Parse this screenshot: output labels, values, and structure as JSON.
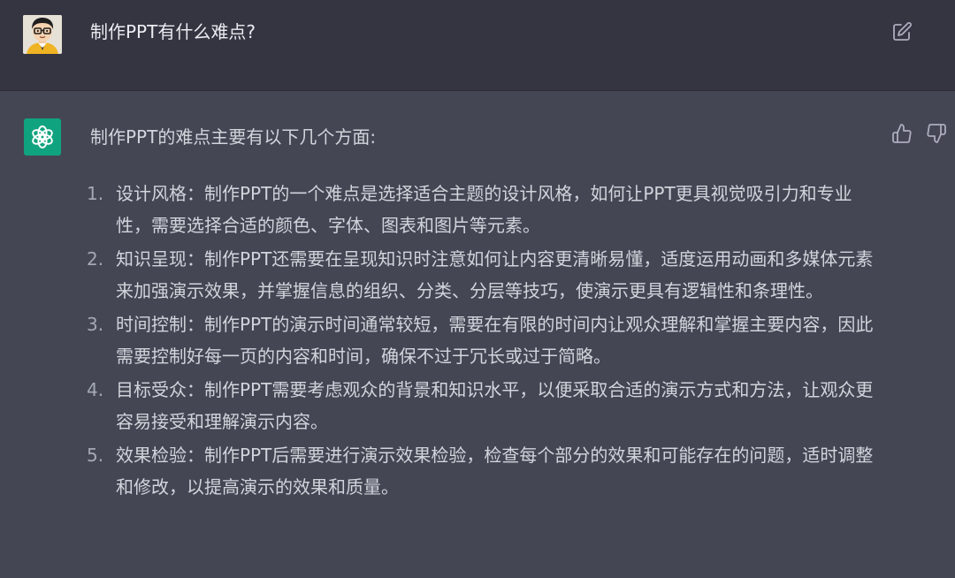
{
  "user_message": {
    "text": "制作PPT有什么难点?",
    "avatar": "cartoon-person-with-glasses-avatar",
    "edit_icon": "edit-icon"
  },
  "assistant_message": {
    "avatar": "openai-logo-icon",
    "intro": "制作PPT的难点主要有以下几个方面:",
    "items": [
      {
        "num": "1.",
        "text": "设计风格：制作PPT的一个难点是选择适合主题的设计风格，如何让PPT更具视觉吸引力和专业性，需要选择合适的颜色、字体、图表和图片等元素。"
      },
      {
        "num": "2.",
        "text": "知识呈现：制作PPT还需要在呈现知识时注意如何让内容更清晰易懂，适度运用动画和多媒体元素来加强演示效果，并掌握信息的组织、分类、分层等技巧，使演示更具有逻辑性和条理性。"
      },
      {
        "num": "3.",
        "text": "时间控制：制作PPT的演示时间通常较短，需要在有限的时间内让观众理解和掌握主要内容，因此需要控制好每一页的内容和时间，确保不过于冗长或过于简略。"
      },
      {
        "num": "4.",
        "text": "目标受众：制作PPT需要考虑观众的背景和知识水平，以便采取合适的演示方式和方法，让观众更容易接受和理解演示内容。"
      },
      {
        "num": "5.",
        "text": "效果检验：制作PPT后需要进行演示效果检验，检查每个部分的效果和可能存在的问题，适时调整和修改，以提高演示的效果和质量。"
      }
    ],
    "feedback_icons": [
      "thumbs-up-icon",
      "thumbs-down-icon"
    ]
  },
  "colors": {
    "user_bg": "#343541",
    "assistant_bg": "#444654",
    "accent": "#10a37f",
    "text": "#d1d5db",
    "icon": "#acacbe"
  }
}
